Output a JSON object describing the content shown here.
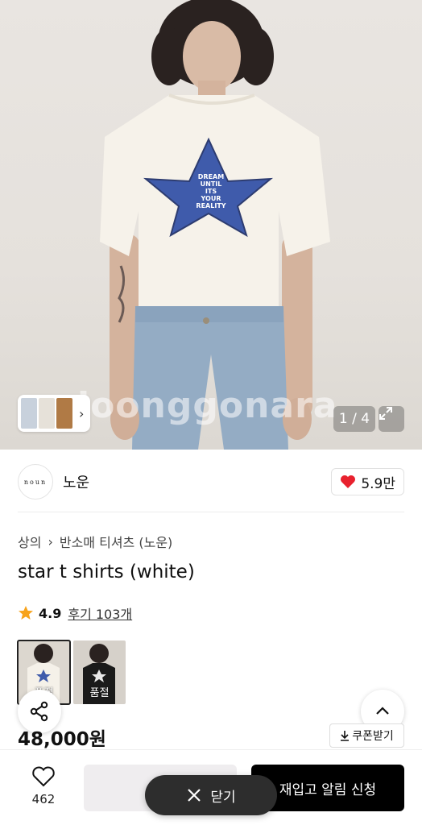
{
  "hero": {
    "watermark": "loonggonara",
    "counter": "1 / 4",
    "shirt_print": [
      "DREAM",
      "UNTIL",
      "ITS",
      "YOUR",
      "REALITY"
    ]
  },
  "brand": {
    "logo_text": "noun",
    "name": "노운",
    "likes": "5.9만"
  },
  "breadcrumb": [
    "상의",
    "반소매 티셔츠 (노운)"
  ],
  "product": {
    "title": "star t shirts (white)",
    "rating": "4.9",
    "reviews": "후기 103개",
    "price": "48,000원"
  },
  "variants": [
    {
      "label": "품절",
      "color": "white"
    },
    {
      "label": "품절",
      "color": "black"
    }
  ],
  "coupon_label": "쿠폰받기",
  "bottom": {
    "wish_count": "462",
    "notify_label": "재입고 알림 신청",
    "close_label": "닫기"
  },
  "colors": {
    "heart": "#e8212e",
    "star": "#f7a31b",
    "primary_button": "#000000"
  }
}
